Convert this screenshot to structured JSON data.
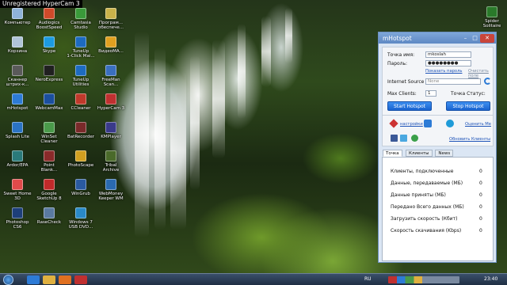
{
  "hypercam_label": "Unregistered HyperCam 3",
  "desktop_icons": [
    {
      "label": "Компьютер",
      "color": "#8fb3d9"
    },
    {
      "label": "Audiogics\nBoostSpeed",
      "color": "#d04a2a"
    },
    {
      "label": "Camtasia\nStudio",
      "color": "#3a9a3a"
    },
    {
      "label": "Програм...\nобеспече...",
      "color": "#c8b24a"
    },
    {
      "label": "Корзина",
      "color": "#b0c4d8"
    },
    {
      "label": "Skype",
      "color": "#1d9be0"
    },
    {
      "label": "TuneUp\n1-Click Mai...",
      "color": "#1d6bc0"
    },
    {
      "label": "ВидеоМА...",
      "color": "#e0a020"
    },
    {
      "label": "Сканнер\nштрих-к...",
      "color": "#5a5a5a"
    },
    {
      "label": "NeroExpress",
      "color": "#202020"
    },
    {
      "label": "TuneUp\nUtilities",
      "color": "#1d6bc0"
    },
    {
      "label": "FreeMan\nScan...",
      "color": "#3a6fbf"
    },
    {
      "label": "mHotspot",
      "color": "#2d7bd6"
    },
    {
      "label": "WebcamMax",
      "color": "#1b4f9e"
    },
    {
      "label": "CCleaner",
      "color": "#c0392b"
    },
    {
      "label": "HyperCam 3",
      "color": "#c03030"
    },
    {
      "label": "Splash Lite",
      "color": "#2a73c4"
    },
    {
      "label": "WinSet\nCleaner",
      "color": "#4a9a4a"
    },
    {
      "label": "BatRecorder",
      "color": "#7a2a2a"
    },
    {
      "label": "KMPlayer",
      "color": "#3a3a8a"
    },
    {
      "label": "Ardor/EPA",
      "color": "#2a7a7a"
    },
    {
      "label": "Point\nBlank...",
      "color": "#8a2a2a"
    },
    {
      "label": "PhotoScape",
      "color": "#d0a020"
    },
    {
      "label": "Tribal\nArchive",
      "color": "#4a6a2a"
    },
    {
      "label": "Sweet Home\n3D",
      "color": "#e04a4a"
    },
    {
      "label": "Google\nSketchUp 8",
      "color": "#c02a2a"
    },
    {
      "label": "WinGrub",
      "color": "#2a5aa0"
    },
    {
      "label": "WebMoney\nKeeper WM",
      "color": "#2a6ab0"
    },
    {
      "label": "Photoshop\nCS6",
      "color": "#1d3f7a"
    },
    {
      "label": "RaseCheck",
      "color": "#5a7aa0"
    },
    {
      "label": "Windows 7\nUSB DVD...",
      "color": "#2a8ac8"
    }
  ],
  "right_icon": {
    "label": "Spider\nSolitaire",
    "color": "#2a7a2a"
  },
  "window": {
    "title": "mHotspot",
    "minimize": "–",
    "maximize": "□",
    "close": "✕",
    "hotspot_name_label": "Точка имя:",
    "hotspot_name_value": "mkoslah",
    "password_label": "Пароль:",
    "password_value": "●●●●●●●●",
    "show_password": "Показать пароль",
    "clear_field": "Очистить поле",
    "internet_source_label": "Internet Source",
    "internet_source_value": "None",
    "max_clients_label": "Max Clients:",
    "max_clients_value": "1",
    "status_label": "Точка Статус:",
    "start_button": "Start Hotspot",
    "stop_button": "Stop Hotspot",
    "settings_link": "настройки",
    "rate_link": "Оценить Ме",
    "update_link": "Обновить Клиенты",
    "tabs": [
      "Точка",
      "Клиенты",
      "News"
    ],
    "stats": [
      {
        "label": "Клиенты, подключенные",
        "value": "0"
      },
      {
        "label": "Данные, передаваемые (МБ)",
        "value": "0"
      },
      {
        "label": "Данные приняты (МБ)",
        "value": "0"
      },
      {
        "label": "Передано Всего данных (МБ)",
        "value": "0"
      },
      {
        "label": "Загрузить скорость (Кбит)",
        "value": "0"
      },
      {
        "label": "Скорость скачивания (Kbps)",
        "value": "0"
      }
    ]
  },
  "taskbar": {
    "language": "RU",
    "clock": "23:40"
  }
}
